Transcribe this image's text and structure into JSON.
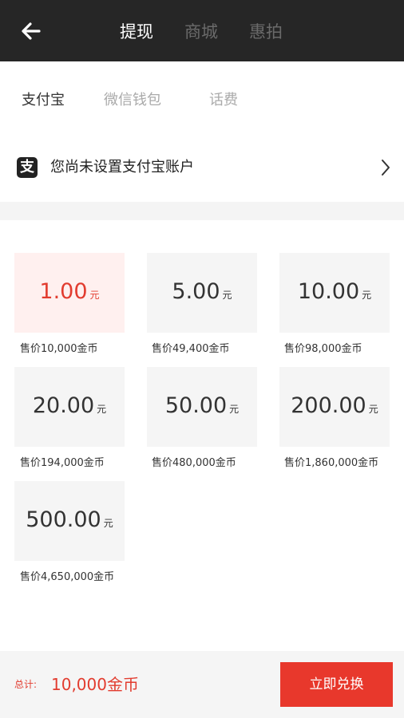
{
  "header": {
    "back_icon": "arrow-left-icon",
    "tabs": [
      {
        "label": "提现",
        "active": true
      },
      {
        "label": "商城",
        "active": false
      },
      {
        "label": "惠拍",
        "active": false
      }
    ]
  },
  "subtabs": [
    {
      "label": "支付宝",
      "active": true
    },
    {
      "label": "微信钱包",
      "active": false
    },
    {
      "label": "话费",
      "active": false
    }
  ],
  "account": {
    "icon": "alipay-icon",
    "icon_glyph": "支",
    "text": "您尚未设置支付宝账户",
    "chevron_icon": "chevron-right-icon"
  },
  "options": [
    {
      "amount": "1.00",
      "unit": "元",
      "price": "售价10,000金币",
      "selected": true
    },
    {
      "amount": "5.00",
      "unit": "元",
      "price": "售价49,400金币",
      "selected": false
    },
    {
      "amount": "10.00",
      "unit": "元",
      "price": "售价98,000金币",
      "selected": false
    },
    {
      "amount": "20.00",
      "unit": "元",
      "price": "售价194,000金币",
      "selected": false
    },
    {
      "amount": "50.00",
      "unit": "元",
      "price": "售价480,000金币",
      "selected": false
    },
    {
      "amount": "200.00",
      "unit": "元",
      "price": "售价1,860,000金币",
      "selected": false
    },
    {
      "amount": "500.00",
      "unit": "元",
      "price": "售价4,650,000金币",
      "selected": false
    }
  ],
  "footer": {
    "total_label": "总计:",
    "total_value": "10,000金币",
    "button_label": "立即兑换"
  },
  "colors": {
    "accent": "#e8382c",
    "header_bg": "#262626",
    "selected_bg": "#fff0ef"
  }
}
